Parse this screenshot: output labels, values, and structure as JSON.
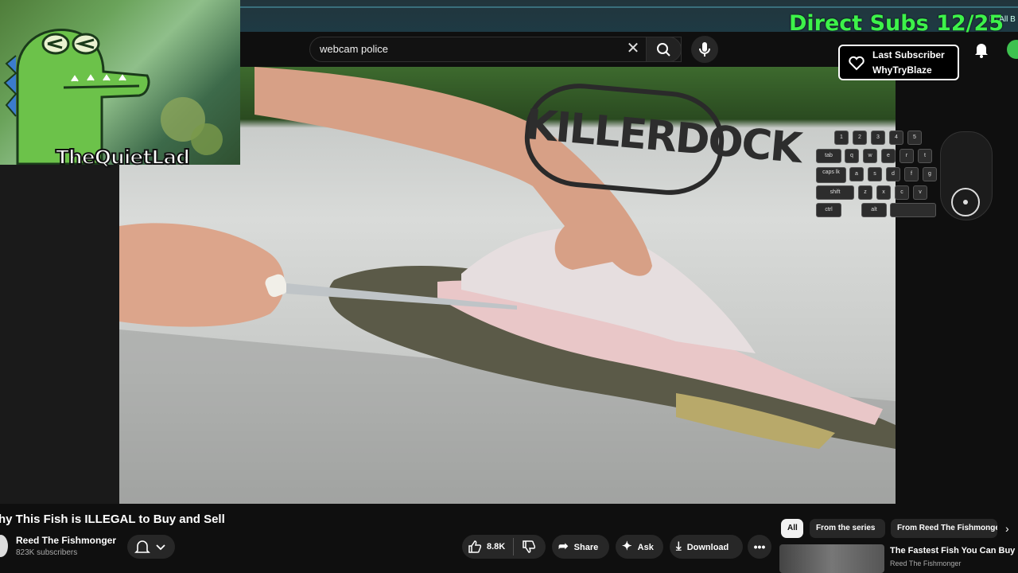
{
  "browser": {
    "bookmarks_label": "All B"
  },
  "search": {
    "query": "webcam police"
  },
  "overlays": {
    "streamer_name": "TheQuietLad",
    "subs_goal": "Direct Subs 12/25",
    "last_subscriber_label": "Last Subscriber",
    "last_subscriber_name": "WhyTryBlaze"
  },
  "video_scene": {
    "dock_brand": "KILLERDOCK"
  },
  "keyboard": {
    "row1": [
      "1",
      "2",
      "3",
      "4",
      "5"
    ],
    "row2": [
      "tab",
      "q",
      "w",
      "e",
      "r",
      "t"
    ],
    "row3": [
      "caps lk",
      "a",
      "s",
      "d",
      "f",
      "g"
    ],
    "row4": [
      "shift",
      "z",
      "x",
      "c",
      "v"
    ],
    "row5": [
      "ctrl",
      "alt"
    ]
  },
  "video": {
    "title": "hy This Fish is ILLEGAL to Buy and Sell",
    "channel": "Reed The Fishmonger",
    "subscribers": "823K subscribers",
    "likes": "8.8K",
    "share_label": "Share",
    "ask_label": "Ask",
    "download_label": "Download"
  },
  "chips": [
    "All",
    "From the series",
    "From Reed The Fishmonger"
  ],
  "recommendation": {
    "title": "The Fastest Fish You Can Buy",
    "channel": "Reed The Fishmonger"
  },
  "colors": {
    "subs_goal": "#3df24a",
    "background": "#0f0f0f",
    "pill": "#272727"
  }
}
